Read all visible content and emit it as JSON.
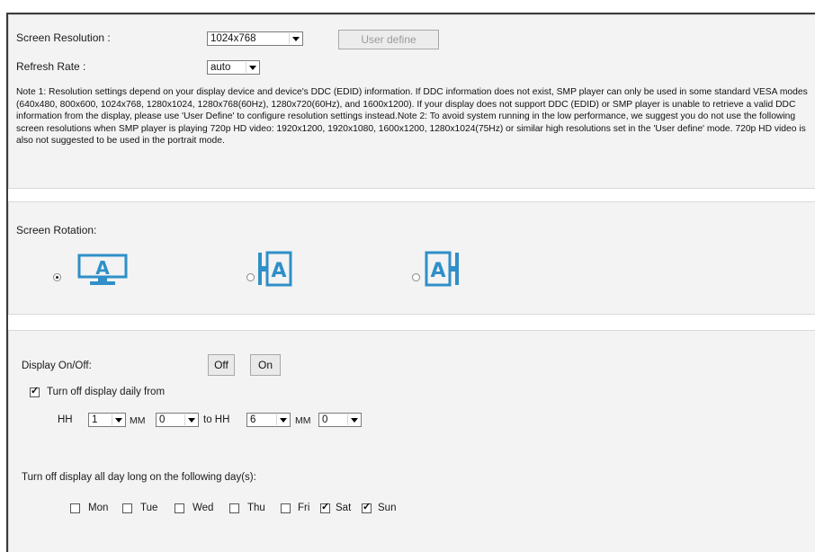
{
  "resolution": {
    "label": "Screen Resolution :",
    "value": "1024x768",
    "user_define_label": "User define"
  },
  "refresh": {
    "label": "Refresh Rate :",
    "value": "auto"
  },
  "note": "Note 1: Resolution settings depend on your display device and device's DDC (EDID) information. If DDC information does not exist, SMP player can only be used in some standard VESA modes (640x480, 800x600, 1024x768, 1280x1024, 1280x768(60Hz), 1280x720(60Hz), and 1600x1200). If your display does not support DDC (EDID) or SMP player is unable to retrieve a valid DDC information from the display, please use 'User Define' to configure resolution settings instead.Note 2: To avoid system running in the low performance, we suggest you do not use the following screen resolutions when SMP player is playing 720p HD video: 1920x1200, 1920x1080, 1600x1200, 1280x1024(75Hz) or similar high resolutions set in the 'User define' mode. 720p HD video is also not suggested to be used in the portrait mode.",
  "rotation": {
    "label": "Screen Rotation:",
    "options": [
      {
        "icon": "landscape-monitor-icon",
        "selected": true
      },
      {
        "icon": "portrait-rotate-left-icon",
        "selected": false
      },
      {
        "icon": "portrait-rotate-right-icon",
        "selected": false
      }
    ],
    "accent_color": "#2f8fc8"
  },
  "display": {
    "label": "Display On/Off:",
    "off_label": "Off",
    "on_label": "On",
    "daily_label": "Turn off display daily from",
    "daily_checked": true,
    "hh_label": "HH",
    "mm_label": "MM",
    "to_label": "to HH",
    "mm2_label": "MM",
    "from_hh": "1",
    "from_mm": "0",
    "to_hh": "6",
    "to_mm": "0",
    "days_label": "Turn off display all day long on the following day(s):",
    "days": [
      {
        "label": "Mon",
        "checked": false
      },
      {
        "label": "Tue",
        "checked": false
      },
      {
        "label": "Wed",
        "checked": false
      },
      {
        "label": "Thu",
        "checked": false
      },
      {
        "label": "Fri",
        "checked": false
      },
      {
        "label": "Sat",
        "checked": true
      },
      {
        "label": "Sun",
        "checked": true
      }
    ]
  }
}
